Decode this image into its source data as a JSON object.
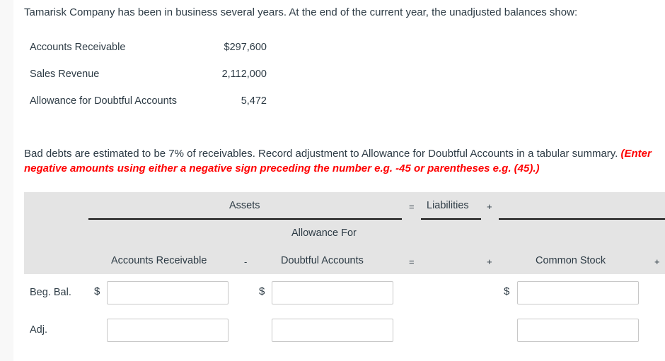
{
  "intro": "Tamarisk Company has been in business several years. At the end of the current year, the unadjusted balances show:",
  "balances": [
    {
      "label": "Accounts Receivable",
      "value": "$297,600"
    },
    {
      "label": "Sales Revenue",
      "value": "2,112,000"
    },
    {
      "label": "Allowance for Doubtful Accounts",
      "value": "5,472"
    }
  ],
  "instruction": {
    "line1_main": "Bad debts are estimated to be 7% of receivables. Record adjustment to Allowance for Doubtful Accounts in a tabular summary. ",
    "line1_red": "(Enter",
    "line2_red": "negative amounts using either a negative sign preceding the number e.g. -45 or parentheses e.g. (45).)"
  },
  "table": {
    "group_assets": "Assets",
    "group_liabilities": "Liabilities",
    "op_equals": "=",
    "op_plus": "+",
    "op_minus": "-",
    "columns": {
      "accounts_receivable": "Accounts Receivable",
      "allowance_line1": "Allowance For",
      "allowance_line2": "Doubtful Accounts",
      "common_stock": "Common Stock"
    },
    "currency_symbol": "$",
    "rows": [
      {
        "label": "Beg. Bal.",
        "ar": "",
        "allowance": "",
        "common_stock": ""
      },
      {
        "label": "Adj.",
        "ar": "",
        "allowance": "",
        "common_stock": ""
      }
    ]
  }
}
